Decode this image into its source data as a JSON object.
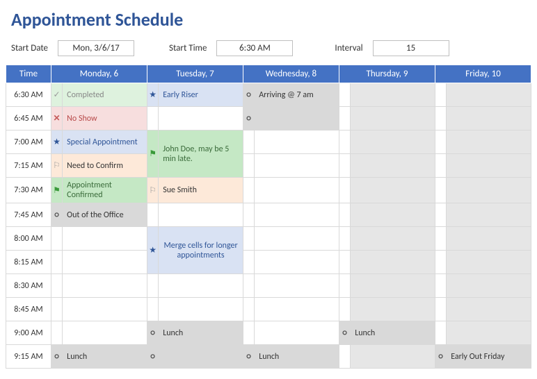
{
  "title": "Appointment Schedule",
  "controls": {
    "startDateLabel": "Start Date",
    "startDate": "Mon, 3/6/17",
    "startTimeLabel": "Start Time",
    "startTime": "6:30 AM",
    "intervalLabel": "Interval",
    "interval": "15"
  },
  "headers": {
    "time": "Time",
    "mon": "Monday, 6",
    "tue": "Tuesday, 7",
    "wed": "Wednesday, 8",
    "thu": "Thursday, 9",
    "fri": "Friday, 10"
  },
  "times": {
    "r0": "6:30 AM",
    "r1": "6:45 AM",
    "r2": "7:00 AM",
    "r3": "7:15 AM",
    "r4": "7:30 AM",
    "r5": "7:45 AM",
    "r6": "8:00 AM",
    "r7": "8:15 AM",
    "r8": "8:30 AM",
    "r9": "8:45 AM",
    "r10": "9:00 AM",
    "r11": "9:15 AM"
  },
  "icons": {
    "check": "✓",
    "x": "✕",
    "star": "★"
  },
  "cells": {
    "mon_r0": "Completed",
    "mon_r1": "No Show",
    "mon_r2": "Special Appointment",
    "mon_r3": "Need to Confirm",
    "mon_r4": "Appointment Confirmed",
    "mon_r5": "Out of the Office",
    "mon_r11": "Lunch",
    "tue_r0": "Early Riser",
    "tue_r2": "John Doe, may be 5 min late.",
    "tue_r4": "Sue Smith",
    "tue_r6": "Merge cells for longer appointments",
    "tue_r10": "Lunch",
    "wed_r0": "Arriving @ 7 am",
    "wed_r11": "Lunch",
    "thu_r10": "Lunch",
    "fri_r11": "Early Out Friday"
  }
}
